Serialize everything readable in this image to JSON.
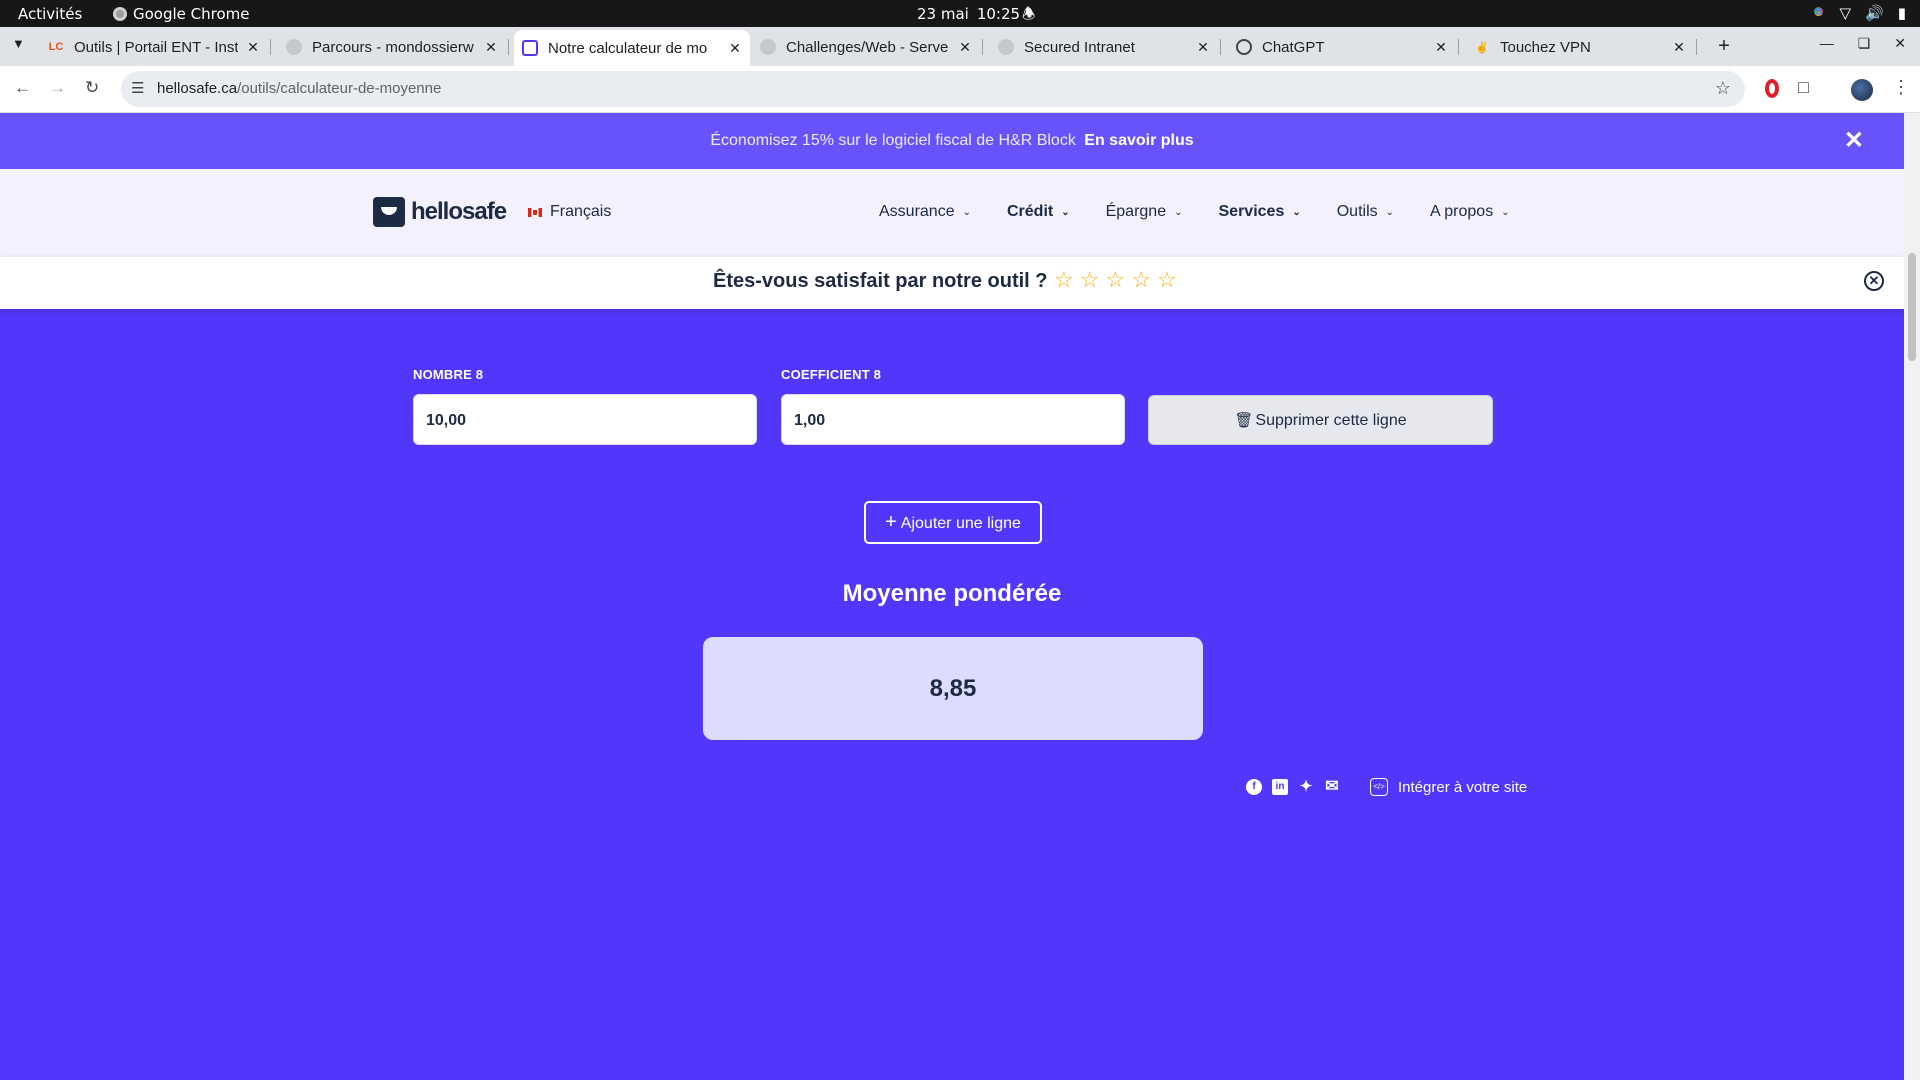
{
  "os_bar": {
    "activities": "Activités",
    "app_name": "Google Chrome",
    "date": "23 mai",
    "time": "10:25"
  },
  "browser": {
    "tabs": [
      {
        "title": "Outils | Portail ENT - Inst",
        "favicon": "lc-logo-icon",
        "active": false
      },
      {
        "title": "Parcours - mondossierw",
        "favicon": "globe-icon",
        "active": false
      },
      {
        "title": "Notre calculateur de mo",
        "favicon": "calculator-icon",
        "active": true
      },
      {
        "title": "Challenges/Web - Serve",
        "favicon": "globe-icon",
        "active": false
      },
      {
        "title": "Secured Intranet",
        "favicon": "globe-icon",
        "active": false
      },
      {
        "title": "ChatGPT",
        "favicon": "chatgpt-icon",
        "active": false
      },
      {
        "title": "Touchez VPN",
        "favicon": "vpn-icon",
        "active": false
      }
    ],
    "url_host": "hellosafe.ca",
    "url_path": "/outils/calculateur-de-moyenne"
  },
  "promo": {
    "text": "Économisez 15% sur le logiciel fiscal de H&R Block",
    "link": "En savoir plus"
  },
  "site_nav": {
    "logo": "hellosafe",
    "language": "Français",
    "menu": [
      "Assurance",
      "Crédit",
      "Épargne",
      "Services",
      "Outils",
      "A propos"
    ]
  },
  "feedback": {
    "question": "Êtes-vous satisfait par notre outil ?",
    "stars": 0,
    "max_stars": 5
  },
  "calculator": {
    "number_label": "NOMBRE 8",
    "number_value": "10,00",
    "coefficient_label": "COEFFICIENT 8",
    "coefficient_value": "1,00",
    "delete_label": "Supprimer cette ligne",
    "add_label": "Ajouter une ligne",
    "result_title": "Moyenne pondérée",
    "result_value": "8,85"
  },
  "footer": {
    "share_icons": [
      "facebook-icon",
      "linkedin-icon",
      "twitter-icon",
      "email-icon"
    ],
    "embed_label": "Intégrer à votre site"
  },
  "colors": {
    "page_bg": "#5237fa",
    "promo_bg": "#6653f9",
    "navy": "#1c2a44",
    "star": "#f2b417",
    "result_bg": "#dddcfc"
  }
}
